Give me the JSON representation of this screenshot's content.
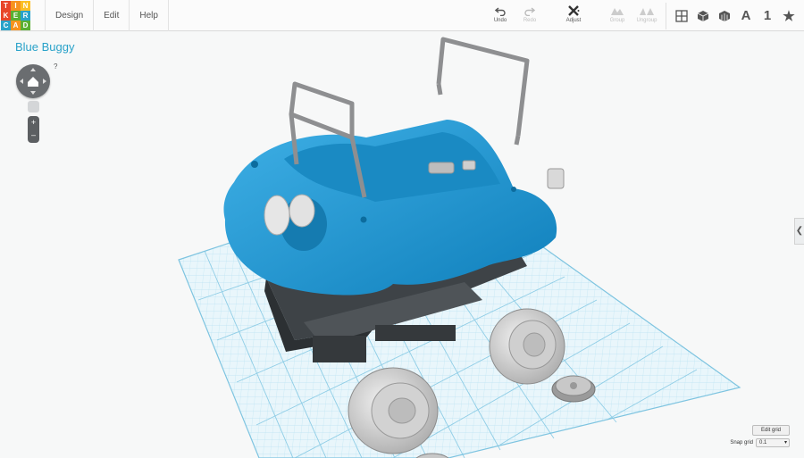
{
  "app": {
    "logo_letters": [
      "T",
      "I",
      "N",
      "K",
      "E",
      "R",
      "C",
      "A",
      "D"
    ],
    "logo_colors": [
      "#e8462a",
      "#f7931e",
      "#fbbf24",
      "#e8462a",
      "#5aaf32",
      "#29a2c9",
      "#29a2c9",
      "#f7931e",
      "#5aaf32"
    ]
  },
  "menu": {
    "items": [
      "Design",
      "Edit",
      "Help"
    ]
  },
  "toolbar": {
    "undo": "Undo",
    "redo": "Redo",
    "adjust": "Adjust",
    "group": "Group",
    "ungroup": "Ungroup"
  },
  "view_icons": {
    "grid_view": "grid-view-icon",
    "cube_view": "cube-view-icon",
    "bricks_view": "bricks-view-icon",
    "letter": "A",
    "number": "1",
    "star": "★"
  },
  "design": {
    "title": "Blue Buggy"
  },
  "navigation": {
    "help": "?",
    "zoom_in": "+",
    "zoom_out": "–"
  },
  "sidepanel": {
    "toggle": "❮"
  },
  "grid": {
    "edit_label": "Edit grid",
    "snap_label": "Snap grid",
    "snap_value": "0.1"
  },
  "colors": {
    "accent": "#29a2c9",
    "body_blue": "#1e93cf",
    "grid_line": "#9fd4ea",
    "chassis": "#4f5458"
  }
}
